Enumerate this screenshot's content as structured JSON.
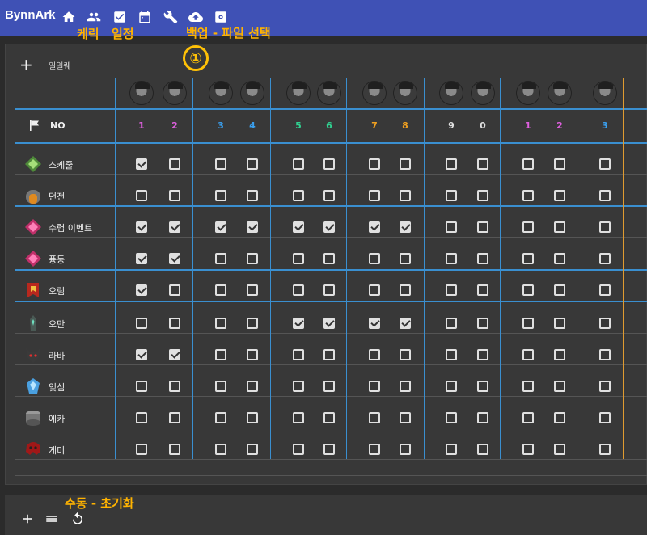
{
  "app": {
    "title": "BynnArk"
  },
  "toolbar": {
    "icons": [
      "home-icon",
      "people-icon",
      "checkbox-icon",
      "calendar-icon",
      "wrench-icon",
      "cloud-upload-icon",
      "settings-icon"
    ]
  },
  "annotations": {
    "char_label": "케릭",
    "schedule_label": "일정",
    "backup_label": "백업 - 파일 선택",
    "circle_marker": "①",
    "reset_label": "수동 - 초기화"
  },
  "daily": {
    "add_symbol": "+",
    "label": "일일퀘"
  },
  "header": {
    "no_label": "NO"
  },
  "characters": [
    {
      "num": "1",
      "color": "#e060e0"
    },
    {
      "num": "2",
      "color": "#e060e0"
    },
    {
      "num": "3",
      "color": "#3aa0f0"
    },
    {
      "num": "4",
      "color": "#3aa0f0"
    },
    {
      "num": "5",
      "color": "#30d090"
    },
    {
      "num": "6",
      "color": "#30d090"
    },
    {
      "num": "7",
      "color": "#f0a020"
    },
    {
      "num": "8",
      "color": "#f0a020"
    },
    {
      "num": "9",
      "color": "#e0e0e0"
    },
    {
      "num": "0",
      "color": "#e0e0e0"
    },
    {
      "num": "1",
      "color": "#e060e0"
    },
    {
      "num": "2",
      "color": "#e060e0"
    },
    {
      "num": "3",
      "color": "#3aa0f0"
    }
  ],
  "tasks": [
    {
      "label": "스케줄",
      "icon": "schedule-rune-icon",
      "checks": [
        1,
        0,
        0,
        0,
        0,
        0,
        0,
        0,
        0,
        0,
        0,
        0,
        0
      ]
    },
    {
      "label": "던전",
      "icon": "dungeon-gate-icon",
      "checks": [
        0,
        0,
        0,
        0,
        0,
        0,
        0,
        0,
        0,
        0,
        0,
        0,
        0
      ]
    },
    {
      "label": "수렵 이벤트",
      "icon": "pink-gem-icon",
      "checks": [
        1,
        1,
        1,
        1,
        1,
        1,
        1,
        1,
        0,
        0,
        0,
        0,
        0
      ]
    },
    {
      "label": "퓽둥",
      "icon": "pink-gem-icon",
      "checks": [
        1,
        1,
        0,
        0,
        0,
        0,
        0,
        0,
        0,
        0,
        0,
        0,
        0
      ]
    },
    {
      "label": "오림",
      "icon": "red-banner-icon",
      "checks": [
        1,
        0,
        0,
        0,
        0,
        0,
        0,
        0,
        0,
        0,
        0,
        0,
        0
      ]
    },
    {
      "label": "오만",
      "icon": "obelisk-icon",
      "checks": [
        0,
        0,
        0,
        0,
        1,
        1,
        1,
        1,
        0,
        0,
        0,
        0,
        0
      ]
    },
    {
      "label": "라바",
      "icon": "demon-mask-icon",
      "checks": [
        1,
        1,
        0,
        0,
        0,
        0,
        0,
        0,
        0,
        0,
        0,
        0,
        0
      ]
    },
    {
      "label": "잊섬",
      "icon": "ice-crystal-icon",
      "checks": [
        0,
        0,
        0,
        0,
        0,
        0,
        0,
        0,
        0,
        0,
        0,
        0,
        0
      ]
    },
    {
      "label": "에카",
      "icon": "drum-icon",
      "checks": [
        0,
        0,
        0,
        0,
        0,
        0,
        0,
        0,
        0,
        0,
        0,
        0,
        0
      ]
    },
    {
      "label": "게미",
      "icon": "red-skull-icon",
      "checks": [
        0,
        0,
        0,
        0,
        0,
        0,
        0,
        0,
        0,
        0,
        0,
        0,
        0
      ]
    }
  ],
  "bottom": {
    "icons": [
      "add-icon",
      "list-icon",
      "reset-icon"
    ]
  }
}
